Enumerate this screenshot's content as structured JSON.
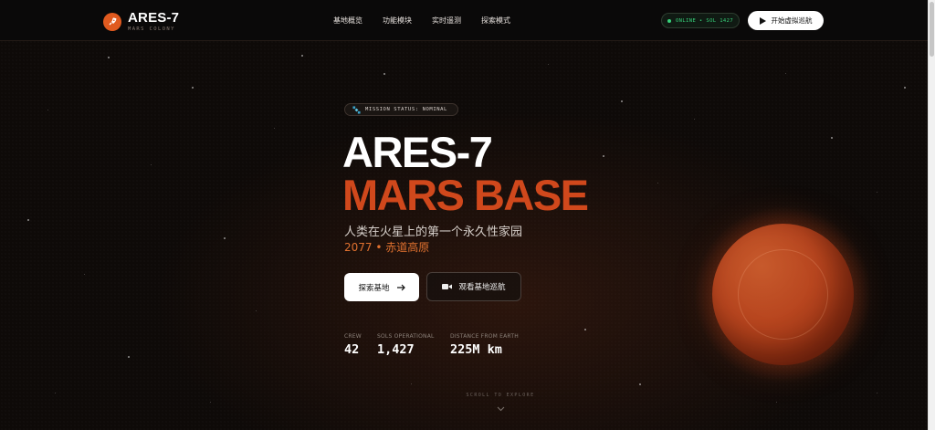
{
  "brand": {
    "name": "ARES-7",
    "subtitle": "MARS COLONY"
  },
  "nav": {
    "links": [
      {
        "label": "基地概览"
      },
      {
        "label": "功能模块"
      },
      {
        "label": "实时遥测"
      },
      {
        "label": "探索模式"
      }
    ],
    "status": "ONLINE • SOL 1427",
    "cta_label": "开始虚拟巡航"
  },
  "hero": {
    "badge": "MISSION STATUS: NOMINAL",
    "title_line1": "ARES-7",
    "title_line2": "MARS BASE",
    "subtitle": "人类在火星上的第一个永久性家园",
    "meta": "2077 • 赤道高原",
    "primary_button": "探索基地",
    "secondary_button": "观看基地巡航"
  },
  "stats": [
    {
      "label": "CREW",
      "value": "42"
    },
    {
      "label": "SOLS OPERATIONAL",
      "value": "1,427"
    },
    {
      "label": "DISTANCE FROM EARTH",
      "value": "225M km"
    }
  ],
  "scroll_hint": "SCROLL TO EXPLORE",
  "colors": {
    "accent": "#d0481c",
    "accent_light": "#e0712f",
    "status_green": "#37d27a",
    "background": "#0e0a08"
  },
  "icons": {
    "brand": "rocket-icon",
    "status": "status-dot-icon",
    "cta": "play-icon",
    "badge": "satellite-icon",
    "primary": "arrow-right-icon",
    "secondary": "video-camera-icon",
    "scroll": "chevron-down-icon"
  }
}
